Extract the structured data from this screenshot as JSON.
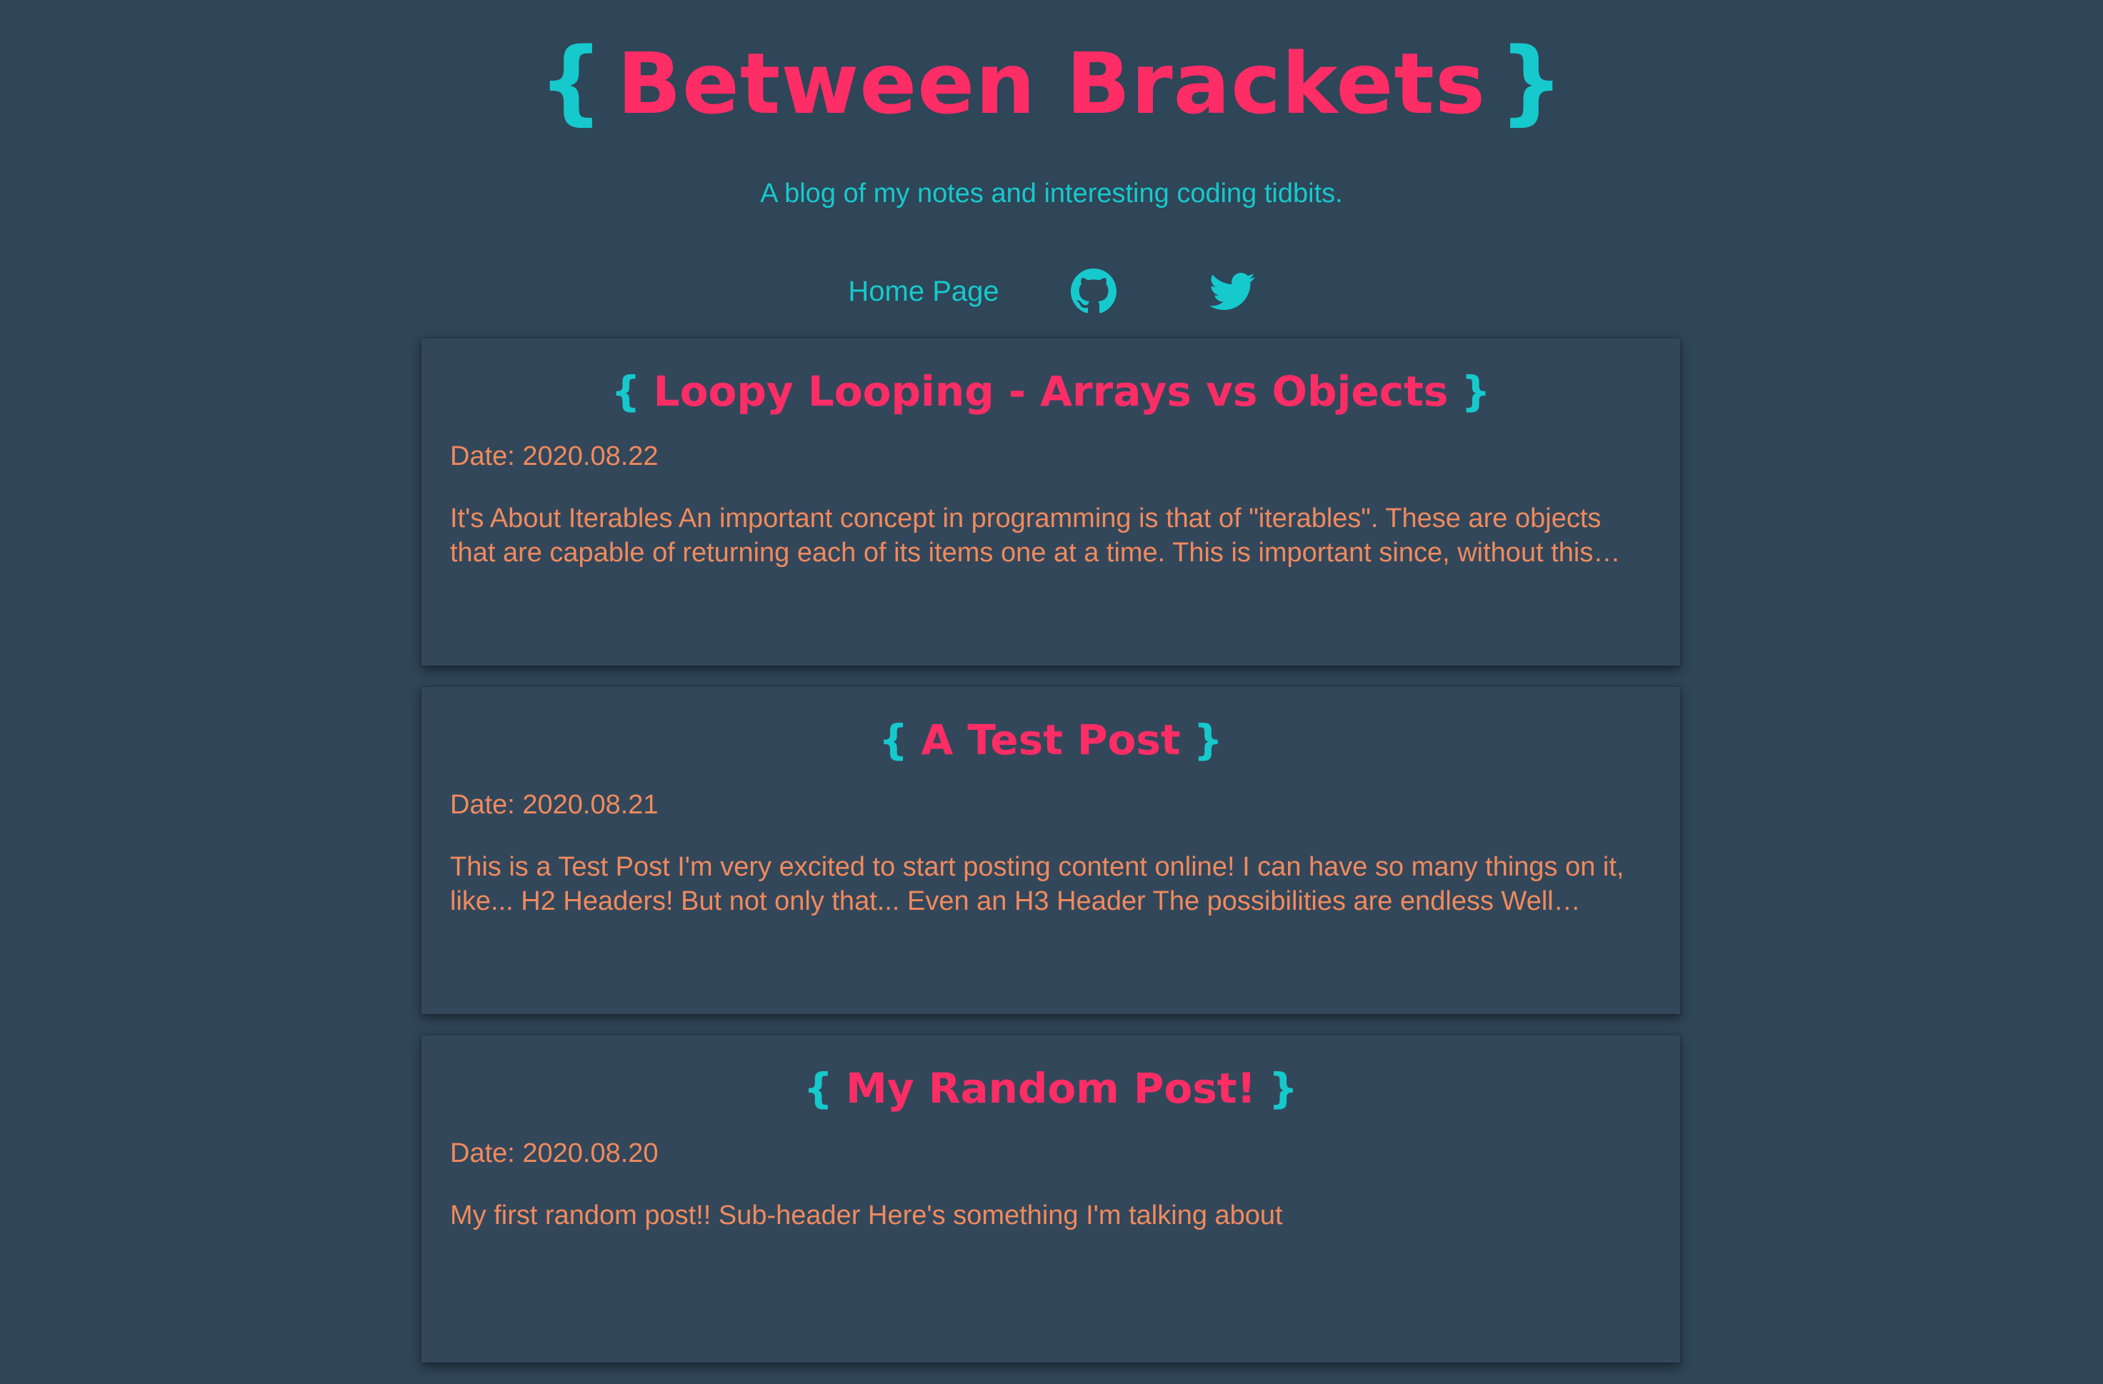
{
  "site": {
    "brace_open": "{",
    "title": "Between Brackets",
    "brace_close": "}",
    "tagline": "A blog of my notes and interesting coding tidbits."
  },
  "nav": {
    "home_label": "Home Page",
    "github_icon": "github-icon",
    "twitter_icon": "twitter-icon"
  },
  "posts": [
    {
      "title": "Loopy Looping - Arrays vs Objects",
      "date": "Date: 2020.08.22",
      "excerpt": "It's About Iterables An important concept in programming is that of \"iterables\". These are objects that are capable of returning each of its items one at a time. This is important since, without this…"
    },
    {
      "title": "A Test Post",
      "date": "Date: 2020.08.21",
      "excerpt": "This is a Test Post I'm very excited to start posting content online! I can have so many things on it, like... H2 Headers! But not only that... Even an H3 Header The possibilities are endless Well…"
    },
    {
      "title": "My Random Post!",
      "date": "Date: 2020.08.20",
      "excerpt": "My first random post!! Sub-header Here's something I'm talking about"
    }
  ],
  "colors": {
    "background": "#2f4558",
    "card": "#33475b",
    "accent_pink": "#ff2d66",
    "accent_cyan": "#16c9cc",
    "text_orange": "#f08a5d"
  }
}
